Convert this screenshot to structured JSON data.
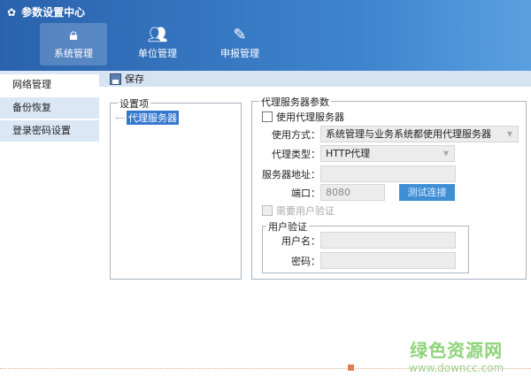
{
  "app": {
    "title": "参数设置中心",
    "icon": "gear-icon"
  },
  "nav": [
    {
      "label": "系统管理",
      "icon": "lock-icon"
    },
    {
      "label": "单位管理",
      "icon": "users-icon"
    },
    {
      "label": "申报管理",
      "icon": "edit-form-icon"
    }
  ],
  "sidebar": [
    {
      "label": "网络管理"
    },
    {
      "label": "备份恢复"
    },
    {
      "label": "登录密码设置"
    }
  ],
  "toolbar": {
    "save_label": "保存"
  },
  "settings": {
    "legend": "设置项",
    "tree_item": "代理服务器"
  },
  "proxy": {
    "legend": "代理服务器参数",
    "use_proxy": "使用代理服务器",
    "mode_label": "使用方式：",
    "mode_value": "系统管理与业务系统都使用代理服务器",
    "type_label": "代理类型：",
    "type_value": "HTTP代理",
    "address_label": "服务器地址：",
    "address_value": "",
    "port_label": "端口：",
    "port_value": "8080",
    "test_button": "测试连接",
    "need_auth": "需要用户验证",
    "auth_legend": "用户验证",
    "username_label": "用户名：",
    "password_label": "密码："
  },
  "watermark": {
    "name": "绿色资源网",
    "url": "www.downcc.com"
  }
}
